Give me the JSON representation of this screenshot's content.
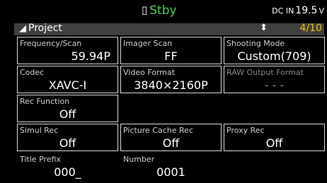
{
  "status": {
    "media_icon": "media-icon",
    "state": "Stby",
    "power_prefix": "DC IN",
    "power_value": "19.5",
    "power_unit": "V"
  },
  "menu": {
    "title": "Project",
    "page": "4/10"
  },
  "cells": [
    {
      "label": "Frequency/Scan",
      "value": "59.94P"
    },
    {
      "label": "Imager Scan",
      "value": "FF"
    },
    {
      "label": "Shooting Mode",
      "value": "Custom(709)"
    },
    {
      "label": "Codec",
      "value": "XAVC-I"
    },
    {
      "label": "Video Format",
      "value": "3840×2160P"
    },
    {
      "label": "RAW Output Format",
      "value": "- - -"
    },
    {
      "label": "Rec Function",
      "value": "Off"
    },
    {
      "label": "Simul Rec",
      "value": "Off"
    },
    {
      "label": "Picture Cache Rec",
      "value": "Off"
    },
    {
      "label": "Proxy Rec",
      "value": "Off"
    },
    {
      "label": "Title Prefix",
      "value": "000_"
    },
    {
      "label": "Number",
      "value": "0001"
    }
  ]
}
